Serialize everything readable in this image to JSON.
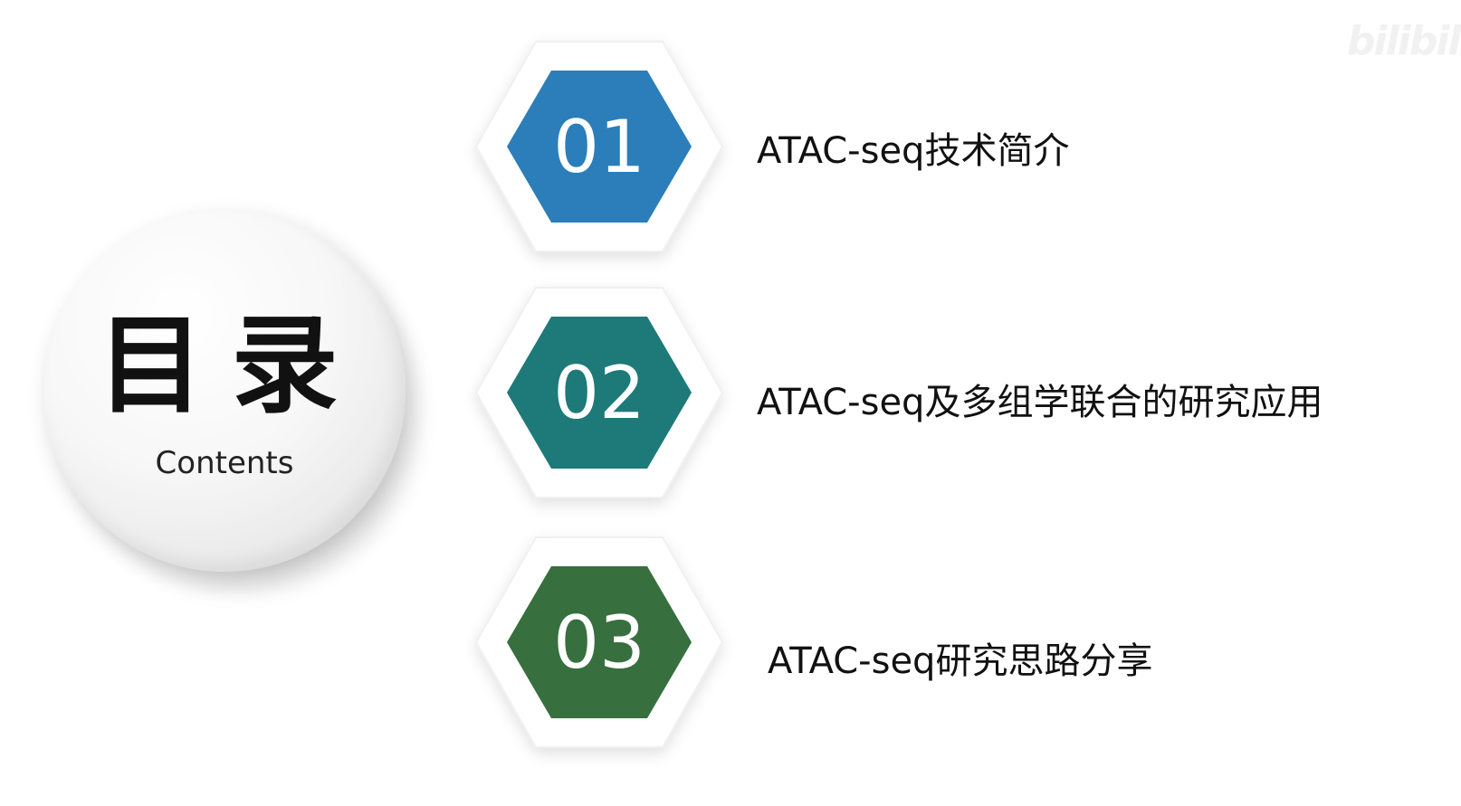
{
  "watermark": "bilibili",
  "header": {
    "title": "目录",
    "subtitle": "Contents"
  },
  "items": [
    {
      "number": "01",
      "label": "ATAC-seq技术简介",
      "color": "#2B7EBA"
    },
    {
      "number": "02",
      "label": "ATAC-seq及多组学联合的研究应用",
      "color": "#1D7A78"
    },
    {
      "number": "03",
      "label": "ATAC-seq研究思路分享",
      "color": "#376F3E"
    }
  ]
}
